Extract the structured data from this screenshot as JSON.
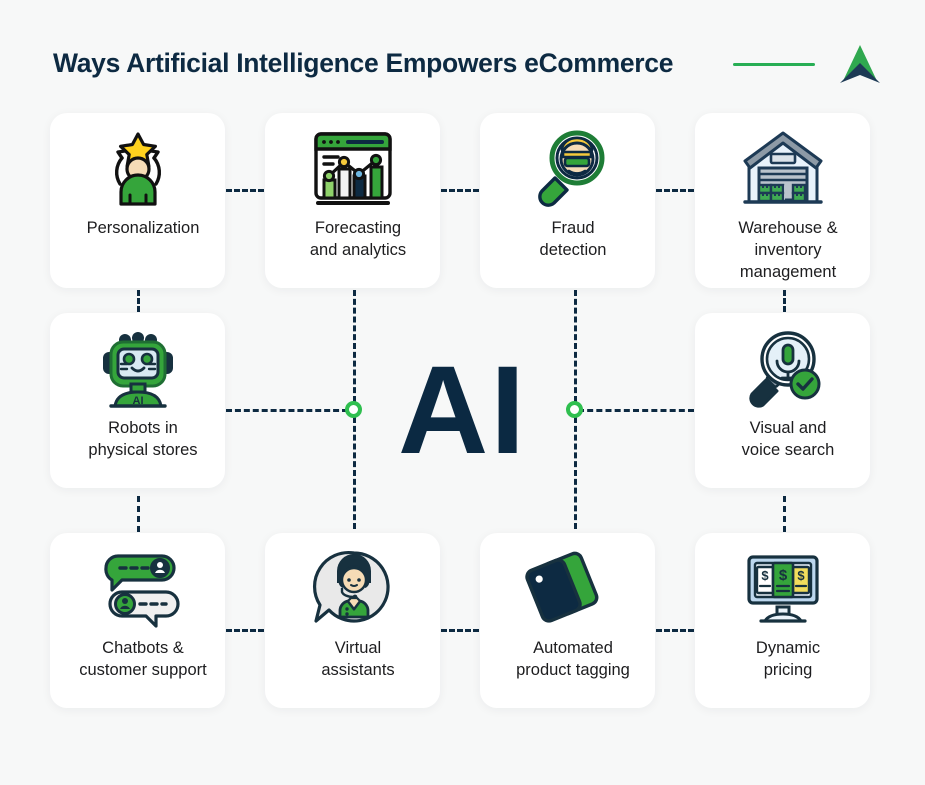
{
  "header": {
    "title": "Ways Artificial Intelligence Empowers eCommerce",
    "rule_color": "#27ae54",
    "title_color": "#0d2a42",
    "logo_name": "arrow-up-logo",
    "logo_colors": {
      "green": "#2fa84f",
      "navy": "#1d3a55"
    }
  },
  "center": {
    "label": "AI",
    "color": "#0b2942"
  },
  "theme": {
    "background": "#f7f8f8",
    "card_background": "#ffffff",
    "connector_color": "#0d2a42",
    "node_ring_color": "#2fbf4f",
    "accent_green": "#2fa84f",
    "text_color": "#1d1d1f"
  },
  "cards": [
    {
      "id": "personalization",
      "label": "Personalization",
      "icon": "person-star-icon",
      "row": 1,
      "col": 1
    },
    {
      "id": "forecasting",
      "label": "Forecasting\nand analytics",
      "icon": "analytics-chart-icon",
      "row": 1,
      "col": 2
    },
    {
      "id": "fraud-detection",
      "label": "Fraud\ndetection",
      "icon": "magnifier-thief-icon",
      "row": 1,
      "col": 3
    },
    {
      "id": "warehouse",
      "label": "Warehouse &\ninventory\nmanagement",
      "icon": "warehouse-icon",
      "row": 1,
      "col": 4
    },
    {
      "id": "robots",
      "label": "Robots in\nphysical stores",
      "icon": "robot-icon",
      "row": 2,
      "col": 1
    },
    {
      "id": "visual-voice-search",
      "label": "Visual and\nvoice search",
      "icon": "magnifier-mic-icon",
      "row": 2,
      "col": 4
    },
    {
      "id": "chatbots",
      "label": "Chatbots &\ncustomer support",
      "icon": "chat-bubbles-icon",
      "row": 3,
      "col": 1
    },
    {
      "id": "virtual-assistants",
      "label": "Virtual\nassistants",
      "icon": "agent-bubble-icon",
      "row": 3,
      "col": 2
    },
    {
      "id": "product-tagging",
      "label": "Automated\nproduct tagging",
      "icon": "price-tags-icon",
      "row": 3,
      "col": 3
    },
    {
      "id": "dynamic-pricing",
      "label": "Dynamic\npricing",
      "icon": "monitor-money-icon",
      "row": 3,
      "col": 4
    }
  ]
}
